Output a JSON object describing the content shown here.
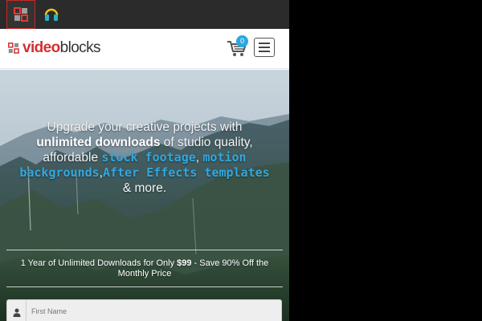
{
  "appbar": {
    "tabs": [
      {
        "icon": "videoblocks-app-icon",
        "active": true
      },
      {
        "icon": "audioblocks-app-icon",
        "active": false
      }
    ]
  },
  "header": {
    "logo": {
      "text_video": "video",
      "text_blocks": "blocks"
    },
    "cart_count": "0",
    "menu_icon": "hamburger-icon"
  },
  "hero": {
    "line1": "Upgrade your creative projects with",
    "line2_bold": "unlimited downloads",
    "line2_rest": " of studio quality,",
    "line3_start": "affordable ",
    "highlight1": "stock footage",
    "sep1": ", ",
    "highlight2": "motion backgrounds",
    "sep2": ",",
    "highlight3": "After Effects templates",
    "ending": " & more.",
    "offer_prefix": "1 Year of Unlimited Downloads for Only ",
    "offer_price": "$99",
    "offer_suffix": " - Save 90% Off the Monthly Price"
  },
  "form": {
    "first_name_placeholder": "First Name"
  },
  "colors": {
    "brand_red": "#d32f2f",
    "accent_blue": "#31a8e0",
    "appbar_bg": "#2b2b2b"
  }
}
